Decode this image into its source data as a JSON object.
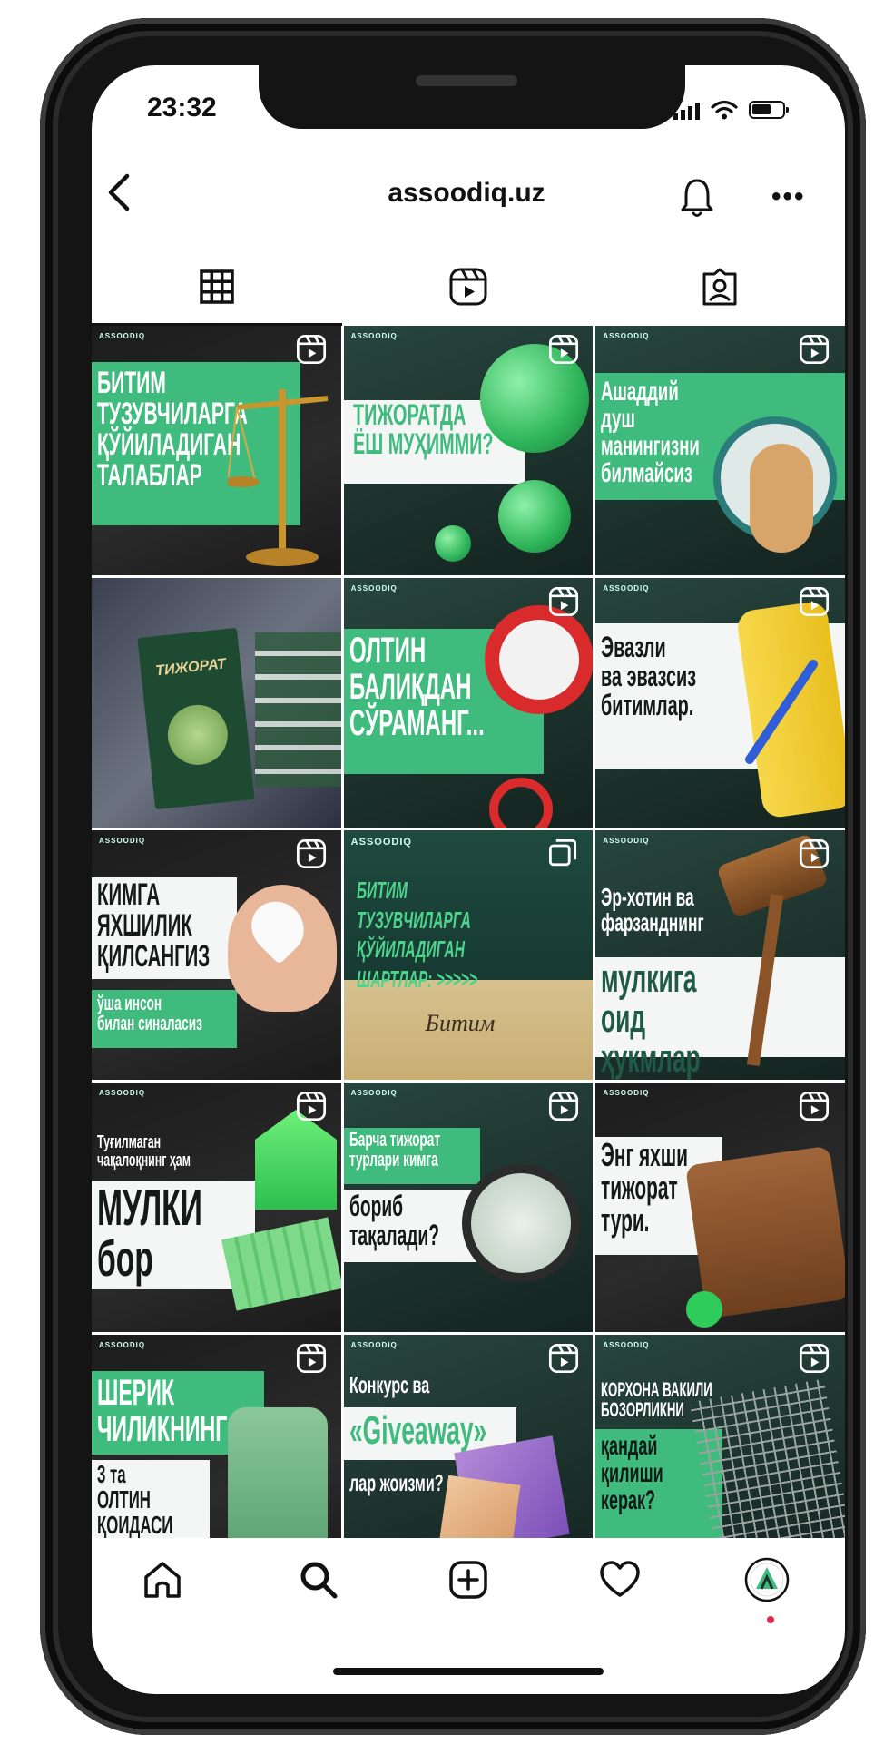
{
  "status_bar": {
    "time": "23:32"
  },
  "header": {
    "username": "assoodiq.uz"
  },
  "tabs": [
    {
      "name": "grid",
      "icon": "grid-icon"
    },
    {
      "name": "reels",
      "icon": "reels-icon"
    },
    {
      "name": "tagged",
      "icon": "tagged-icon"
    }
  ],
  "posts": [
    {
      "brand": "ASSOODIQ",
      "text": "БИТИМ\nТУЗУВЧИЛАРГА\nҚЎЙИЛАДИГАН\nТАЛАБЛАР"
    },
    {
      "brand": "ASSOODIQ",
      "text": "ТИЖОРАТДА\nЁШ МУҲИММИ?"
    },
    {
      "brand": "ASSOODIQ",
      "text": "Ашаддий\nдуш\nманингизни\nбилмайсиз"
    },
    {
      "brand": "",
      "text": "ТИЖОРАТ"
    },
    {
      "brand": "ASSOODIQ",
      "text": "ОЛТИН\nБАЛИҚДАН\nСЎРАМАНГ..."
    },
    {
      "brand": "ASSOODIQ",
      "text": "Эвазли\nва эвазсиз\nбитимлар."
    },
    {
      "brand": "ASSOODIQ",
      "text": "КИМГА\nЯХШИЛИК\nҚИЛСАНГИЗ",
      "subtext": "ўша инсон\nбилан синаласиз"
    },
    {
      "brand": "ASSOODIQ",
      "text": "БИТИМ ТУЗУВЧИЛАРГА\nҚЎЙИЛАДИГАН\nШАРТЛАР: >>>>>",
      "subtext": "Битим"
    },
    {
      "brand": "ASSOODIQ",
      "text": "Эр-хотин ва\nфарзанднинг",
      "subtext": "мулкига\nоид ҳукмлар"
    },
    {
      "brand": "ASSOODIQ",
      "text": "Туғилмаган\nчақалоқнинг ҳам",
      "subtext": "МУЛКИ\nбор"
    },
    {
      "brand": "ASSOODIQ",
      "text": "Барча тижорат\nтурлари кимга",
      "subtext": "бориб\nтақалади?"
    },
    {
      "brand": "ASSOODIQ",
      "text": "Энг яхши\nтижорат\nтури."
    },
    {
      "brand": "ASSOODIQ",
      "text": "ШЕРИК\nЧИЛИКНИНГ",
      "subtext": "3 та\nОЛТИН\nҚОИДАСИ"
    },
    {
      "brand": "ASSOODIQ",
      "text": "Конкурс ва",
      "subtext": "«Giveaway»",
      "subtext2": "лар жоизми?"
    },
    {
      "brand": "ASSOODIQ",
      "text": "КОРХОНА ВАКИЛИ\nБОЗОРЛИКНИ",
      "subtext": "қандай\nқилиши\nкерак?"
    }
  ],
  "nav": [
    {
      "name": "home",
      "icon": "home-icon"
    },
    {
      "name": "search",
      "icon": "search-icon"
    },
    {
      "name": "new-post",
      "icon": "add-post-icon"
    },
    {
      "name": "activity",
      "icon": "heart-icon"
    },
    {
      "name": "profile",
      "icon": "profile-avatar-icon"
    }
  ],
  "colors": {
    "accent": "#3fbb7d",
    "dark_green": "#1d332d",
    "notification_dot": "#e5284a"
  }
}
